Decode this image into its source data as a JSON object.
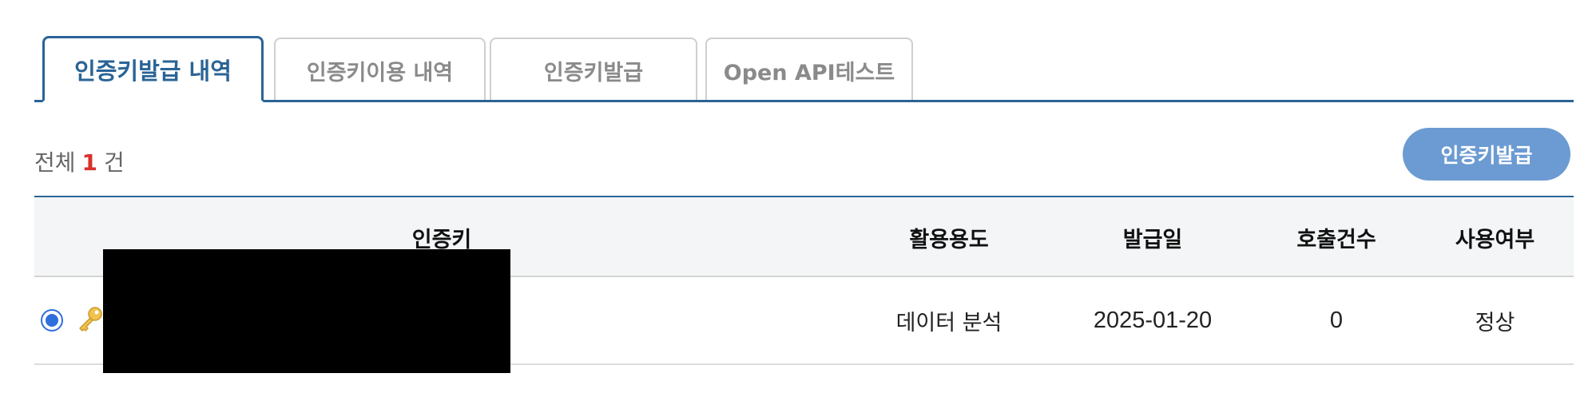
{
  "tabs": [
    {
      "label": "인증키발급 내역",
      "active": true
    },
    {
      "label": "인증키이용 내역",
      "active": false
    },
    {
      "label": "인증키발급",
      "active": false
    },
    {
      "label": "Open API테스트",
      "active": false
    }
  ],
  "summary": {
    "prefix": "전체",
    "count": "1",
    "suffix": "건"
  },
  "issue_button": {
    "label": "인증키발급"
  },
  "table": {
    "headers": {
      "key": "인증키",
      "usage": "활용용도",
      "date": "발급일",
      "calls": "호출건수",
      "status": "사용여부"
    },
    "rows": [
      {
        "selected": true,
        "key_icon": "key-icon",
        "usage": "데이터 분석",
        "date": "2025-01-20",
        "calls": "0",
        "status": "정상"
      }
    ]
  },
  "colors": {
    "accent": "#2a6496",
    "button": "#6b9bd2",
    "count_highlight": "#d9302c",
    "radio": "#2f6fdc"
  }
}
